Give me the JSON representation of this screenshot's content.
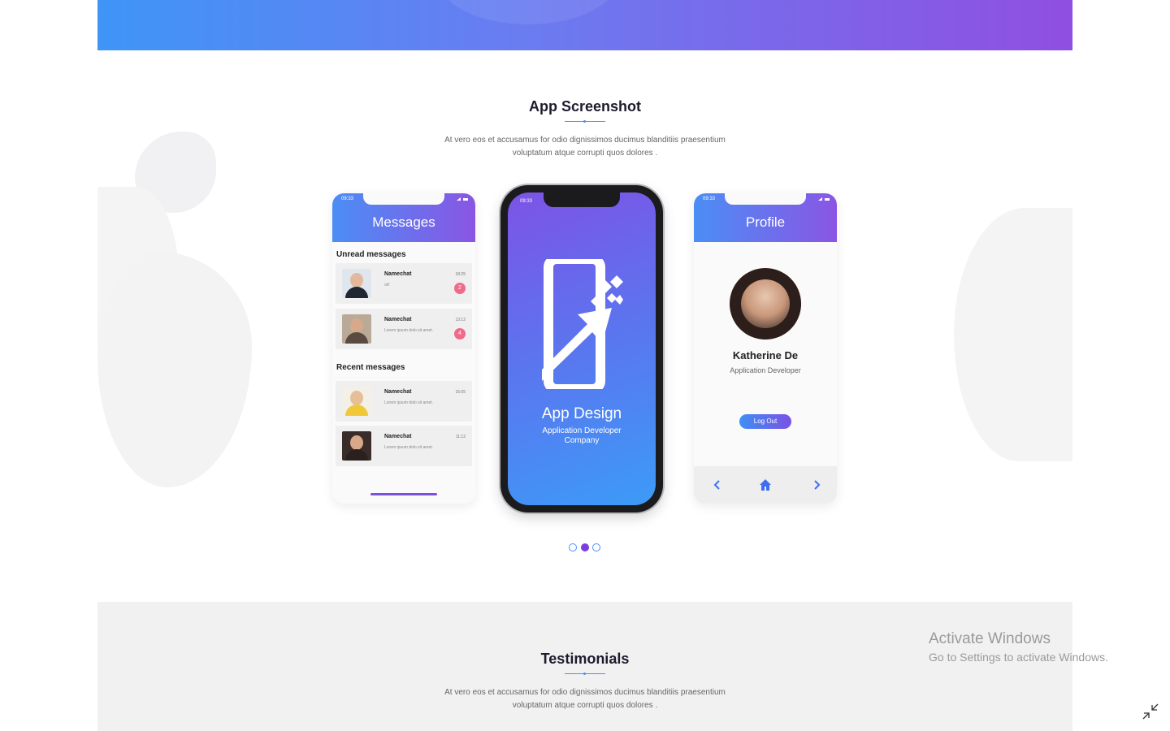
{
  "app_screenshot": {
    "title": "App Screenshot",
    "description": "At vero eos et accusamus for odio dignissimos ducimus blanditiis praesentium voluptatum atque corrupti quos dolores ."
  },
  "messages_phone": {
    "time": "09:33",
    "header": "Messages",
    "unread_label": "Unread messages",
    "recent_label": "Recent messages",
    "unread": [
      {
        "name": "Namechat",
        "text": "ok!",
        "time": "18:25",
        "badge": "2"
      },
      {
        "name": "Namechat",
        "text": "Lorem ipsum dolo sit amet.",
        "time": "13:12",
        "badge": "4"
      }
    ],
    "recent": [
      {
        "name": "Namechat",
        "text": "Lorem ipsum dolo sit amet.",
        "time": "15:05"
      },
      {
        "name": "Namechat",
        "text": "Lorem ipsum dolo sit amet.",
        "time": "11:12"
      }
    ]
  },
  "center_phone": {
    "time": "09:33",
    "app_title": "App Design",
    "app_subtitle_line1": "Application Developer",
    "app_subtitle_line2": "Company"
  },
  "profile_phone": {
    "time": "09:33",
    "header": "Profile",
    "name": "Katherine De",
    "role": "Application Developer",
    "logout_label": "Log Out"
  },
  "carousel": {
    "dot_count": 3,
    "active_index": 1
  },
  "testimonials": {
    "title": "Testimonials",
    "description": "At vero eos et accusamus for odio dignissimos ducimus blanditiis praesentium voluptatum atque corrupti quos dolores ."
  },
  "watermark": {
    "title": "Activate Windows",
    "subtitle": "Go to Settings to activate Windows."
  },
  "colors": {
    "gradient_start": "#3f95f7",
    "gradient_end": "#8f4fe0",
    "badge": "#f06a8a",
    "accent": "#4a8ff7"
  },
  "icons": [
    "chevron-left-icon",
    "home-icon",
    "chevron-right-icon",
    "restore-down-icon"
  ]
}
